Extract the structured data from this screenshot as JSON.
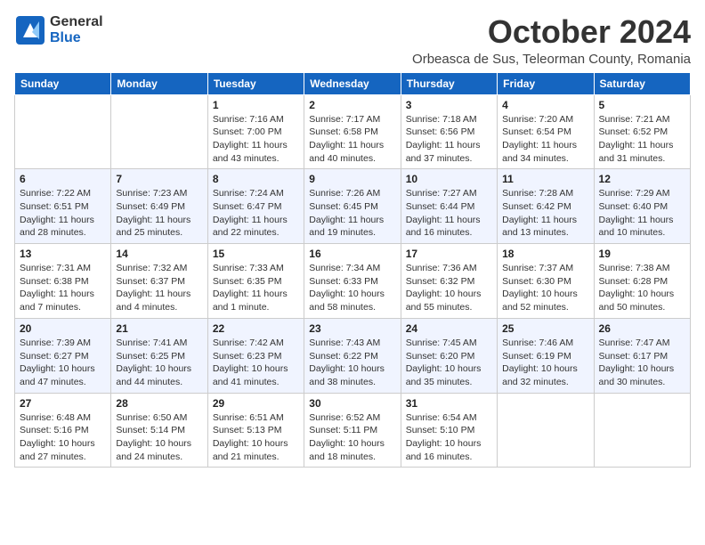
{
  "header": {
    "logo_line1": "General",
    "logo_line2": "Blue",
    "month_title": "October 2024",
    "location": "Orbeasca de Sus, Teleorman County, Romania"
  },
  "weekdays": [
    "Sunday",
    "Monday",
    "Tuesday",
    "Wednesday",
    "Thursday",
    "Friday",
    "Saturday"
  ],
  "weeks": [
    [
      {
        "day": "",
        "info": ""
      },
      {
        "day": "",
        "info": ""
      },
      {
        "day": "1",
        "info": "Sunrise: 7:16 AM\nSunset: 7:00 PM\nDaylight: 11 hours and 43 minutes."
      },
      {
        "day": "2",
        "info": "Sunrise: 7:17 AM\nSunset: 6:58 PM\nDaylight: 11 hours and 40 minutes."
      },
      {
        "day": "3",
        "info": "Sunrise: 7:18 AM\nSunset: 6:56 PM\nDaylight: 11 hours and 37 minutes."
      },
      {
        "day": "4",
        "info": "Sunrise: 7:20 AM\nSunset: 6:54 PM\nDaylight: 11 hours and 34 minutes."
      },
      {
        "day": "5",
        "info": "Sunrise: 7:21 AM\nSunset: 6:52 PM\nDaylight: 11 hours and 31 minutes."
      }
    ],
    [
      {
        "day": "6",
        "info": "Sunrise: 7:22 AM\nSunset: 6:51 PM\nDaylight: 11 hours and 28 minutes."
      },
      {
        "day": "7",
        "info": "Sunrise: 7:23 AM\nSunset: 6:49 PM\nDaylight: 11 hours and 25 minutes."
      },
      {
        "day": "8",
        "info": "Sunrise: 7:24 AM\nSunset: 6:47 PM\nDaylight: 11 hours and 22 minutes."
      },
      {
        "day": "9",
        "info": "Sunrise: 7:26 AM\nSunset: 6:45 PM\nDaylight: 11 hours and 19 minutes."
      },
      {
        "day": "10",
        "info": "Sunrise: 7:27 AM\nSunset: 6:44 PM\nDaylight: 11 hours and 16 minutes."
      },
      {
        "day": "11",
        "info": "Sunrise: 7:28 AM\nSunset: 6:42 PM\nDaylight: 11 hours and 13 minutes."
      },
      {
        "day": "12",
        "info": "Sunrise: 7:29 AM\nSunset: 6:40 PM\nDaylight: 11 hours and 10 minutes."
      }
    ],
    [
      {
        "day": "13",
        "info": "Sunrise: 7:31 AM\nSunset: 6:38 PM\nDaylight: 11 hours and 7 minutes."
      },
      {
        "day": "14",
        "info": "Sunrise: 7:32 AM\nSunset: 6:37 PM\nDaylight: 11 hours and 4 minutes."
      },
      {
        "day": "15",
        "info": "Sunrise: 7:33 AM\nSunset: 6:35 PM\nDaylight: 11 hours and 1 minute."
      },
      {
        "day": "16",
        "info": "Sunrise: 7:34 AM\nSunset: 6:33 PM\nDaylight: 10 hours and 58 minutes."
      },
      {
        "day": "17",
        "info": "Sunrise: 7:36 AM\nSunset: 6:32 PM\nDaylight: 10 hours and 55 minutes."
      },
      {
        "day": "18",
        "info": "Sunrise: 7:37 AM\nSunset: 6:30 PM\nDaylight: 10 hours and 52 minutes."
      },
      {
        "day": "19",
        "info": "Sunrise: 7:38 AM\nSunset: 6:28 PM\nDaylight: 10 hours and 50 minutes."
      }
    ],
    [
      {
        "day": "20",
        "info": "Sunrise: 7:39 AM\nSunset: 6:27 PM\nDaylight: 10 hours and 47 minutes."
      },
      {
        "day": "21",
        "info": "Sunrise: 7:41 AM\nSunset: 6:25 PM\nDaylight: 10 hours and 44 minutes."
      },
      {
        "day": "22",
        "info": "Sunrise: 7:42 AM\nSunset: 6:23 PM\nDaylight: 10 hours and 41 minutes."
      },
      {
        "day": "23",
        "info": "Sunrise: 7:43 AM\nSunset: 6:22 PM\nDaylight: 10 hours and 38 minutes."
      },
      {
        "day": "24",
        "info": "Sunrise: 7:45 AM\nSunset: 6:20 PM\nDaylight: 10 hours and 35 minutes."
      },
      {
        "day": "25",
        "info": "Sunrise: 7:46 AM\nSunset: 6:19 PM\nDaylight: 10 hours and 32 minutes."
      },
      {
        "day": "26",
        "info": "Sunrise: 7:47 AM\nSunset: 6:17 PM\nDaylight: 10 hours and 30 minutes."
      }
    ],
    [
      {
        "day": "27",
        "info": "Sunrise: 6:48 AM\nSunset: 5:16 PM\nDaylight: 10 hours and 27 minutes."
      },
      {
        "day": "28",
        "info": "Sunrise: 6:50 AM\nSunset: 5:14 PM\nDaylight: 10 hours and 24 minutes."
      },
      {
        "day": "29",
        "info": "Sunrise: 6:51 AM\nSunset: 5:13 PM\nDaylight: 10 hours and 21 minutes."
      },
      {
        "day": "30",
        "info": "Sunrise: 6:52 AM\nSunset: 5:11 PM\nDaylight: 10 hours and 18 minutes."
      },
      {
        "day": "31",
        "info": "Sunrise: 6:54 AM\nSunset: 5:10 PM\nDaylight: 10 hours and 16 minutes."
      },
      {
        "day": "",
        "info": ""
      },
      {
        "day": "",
        "info": ""
      }
    ]
  ]
}
